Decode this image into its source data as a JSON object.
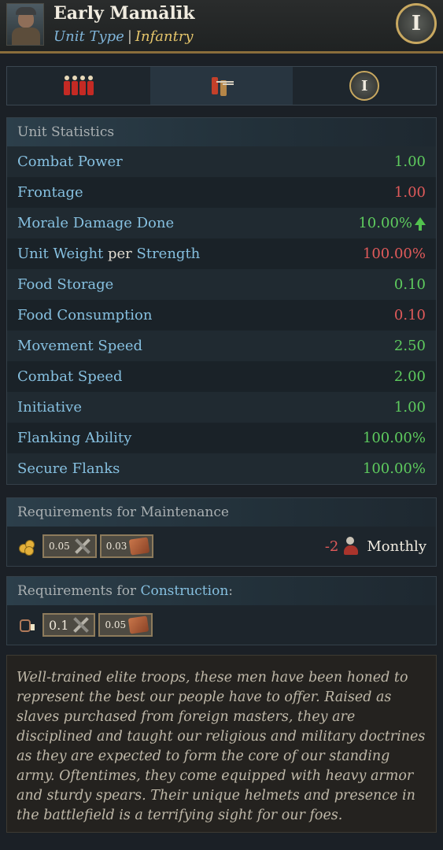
{
  "header": {
    "unit_name": "Early Mamālīk",
    "type_label": "Unit Type",
    "separator": "|",
    "category": "Infantry",
    "era_badge": "I",
    "portrait_icon": "soldier-portrait"
  },
  "tabs": [
    {
      "icon": "infantry-formation-icon"
    },
    {
      "icon": "gunners-icon"
    },
    {
      "icon": "era-badge-icon",
      "label": "I"
    }
  ],
  "stats": {
    "title": "Unit Statistics",
    "rows": [
      {
        "label": "Combat Power",
        "value": "1.00",
        "color": "#5ecb5e"
      },
      {
        "label": "Frontage",
        "value": "1.00",
        "color": "#e05a5a"
      },
      {
        "label": "Morale Damage Done",
        "value": "10.00%",
        "color": "#5ecb5e",
        "icon": "arrow-up-icon"
      },
      {
        "label_part1": "Unit Weight",
        "label_part2": "per",
        "label_part3": "Strength",
        "value": "100.00%",
        "color": "#e05a5a"
      },
      {
        "label": "Food Storage",
        "value": "0.10",
        "color": "#5ecb5e"
      },
      {
        "label": "Food Consumption",
        "value": "0.10",
        "color": "#e05a5a"
      },
      {
        "label": "Movement Speed",
        "value": "2.50",
        "color": "#5ecb5e"
      },
      {
        "label": "Combat Speed",
        "value": "2.00",
        "color": "#5ecb5e"
      },
      {
        "label": "Initiative",
        "value": "1.00",
        "color": "#5ecb5e"
      },
      {
        "label": "Flanking Ability",
        "value": "100.00%",
        "color": "#5ecb5e"
      },
      {
        "label": "Secure Flanks",
        "value": "100.00%",
        "color": "#5ecb5e"
      }
    ]
  },
  "maintenance": {
    "title": "Requirements for Maintenance",
    "lead_icon": "gold-coins-icon",
    "resources": [
      {
        "amount": "0.05",
        "icon": "tools-icon"
      },
      {
        "amount": "0.03",
        "icon": "leather-icon"
      }
    ],
    "population_change": "-2",
    "population_icon": "population-icon",
    "period": "Monthly"
  },
  "construction": {
    "title_part1": "Requirements for",
    "title_part2": "Construction",
    "title_part3": ":",
    "lead_icon": "recruit-icon",
    "resources": [
      {
        "amount": "0.1",
        "icon": "tools-icon"
      },
      {
        "amount": "0.05",
        "icon": "leather-icon"
      }
    ]
  },
  "description": "Well-trained elite troops, these men have been honed to represent the best our people have to offer. Raised as slaves purchased from foreign masters, they are disciplined and taught our religious and military doctrines as they are expected to form the core of our standing army. Oftentimes, they come equipped with heavy armor and sturdy spears. Their unique helmets and presence in the battlefield is a terrifying sight for our foes."
}
